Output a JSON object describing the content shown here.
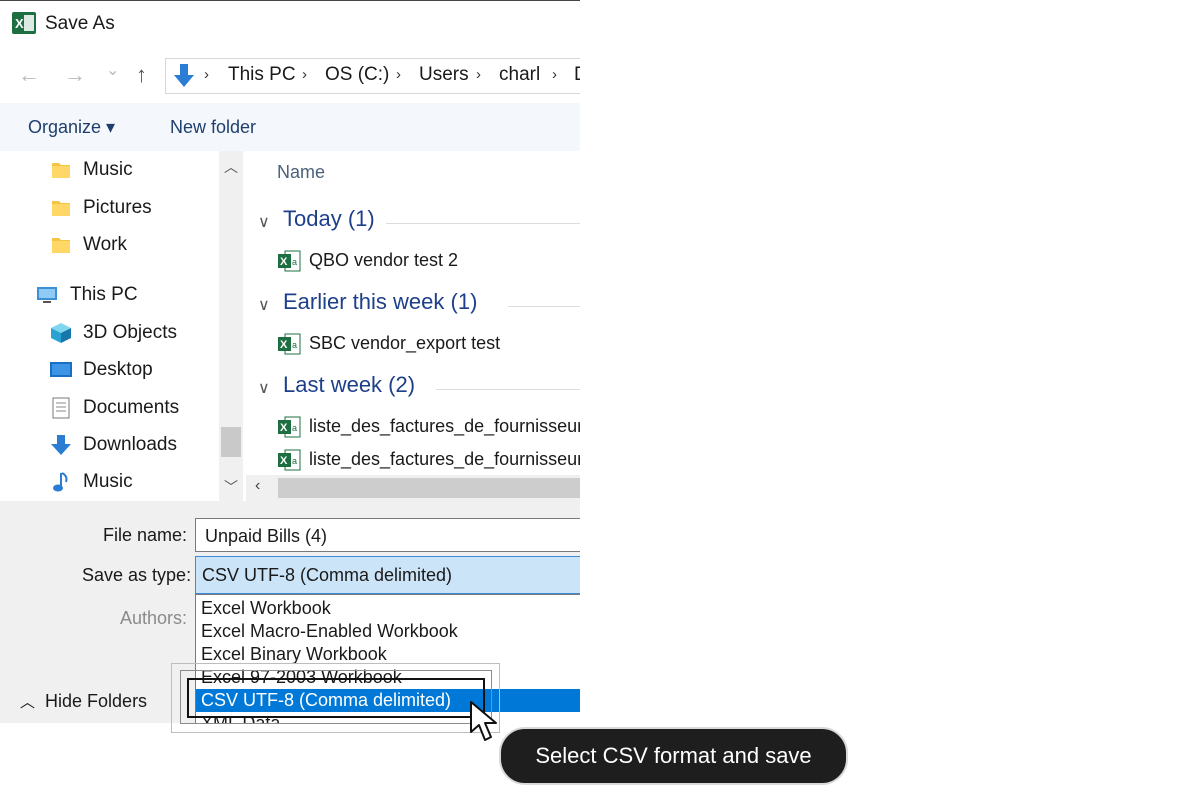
{
  "window": {
    "title": "Save As"
  },
  "nav": {
    "back": "←",
    "forward": "→",
    "recent": "⌄",
    "up": "↑",
    "path": [
      "This PC",
      "OS (C:)",
      "Users",
      "charl",
      "D"
    ]
  },
  "toolbar": {
    "organize": "Organize ▾",
    "new_folder": "New folder"
  },
  "sidebar": {
    "items": [
      {
        "label": "Music",
        "icon": "folder-icon"
      },
      {
        "label": "Pictures",
        "icon": "folder-icon"
      },
      {
        "label": "Work",
        "icon": "folder-icon"
      },
      {
        "label": "This PC",
        "icon": "computer-icon"
      },
      {
        "label": "3D Objects",
        "icon": "cube-icon"
      },
      {
        "label": "Desktop",
        "icon": "desktop-icon"
      },
      {
        "label": "Documents",
        "icon": "documents-icon"
      },
      {
        "label": "Downloads",
        "icon": "download-icon"
      },
      {
        "label": "Music",
        "icon": "music-icon"
      }
    ]
  },
  "filelist": {
    "column_name": "Name",
    "groups": [
      {
        "title": "Today (1)",
        "files": [
          "QBO vendor test 2"
        ]
      },
      {
        "title": "Earlier this week (1)",
        "files": [
          "SBC vendor_export test"
        ]
      },
      {
        "title": "Last week (2)",
        "files": [
          "liste_des_factures_de_fournisseur",
          "liste_des_factures_de_fournisseur"
        ]
      }
    ]
  },
  "form": {
    "file_name_label": "File name:",
    "file_name_value": "Unpaid Bills (4)",
    "save_type_label": "Save as type:",
    "save_type_value": "CSV UTF-8 (Comma delimited)",
    "authors_label": "Authors:",
    "hide_folders": "Hide Folders",
    "type_options": [
      "Excel Workbook",
      "Excel Macro-Enabled Workbook",
      "Excel Binary Workbook",
      "Excel 97-2003 Workbook",
      "CSV UTF-8 (Comma delimited)",
      "XML Data"
    ],
    "selected_option_index": 4
  },
  "callout": {
    "text": "Select CSV format and save"
  },
  "colors": {
    "accent": "#0078d7",
    "group_title": "#1e3f8a",
    "selection_bg": "#cce4f7",
    "tooltip_bg": "#1e1e1e"
  }
}
